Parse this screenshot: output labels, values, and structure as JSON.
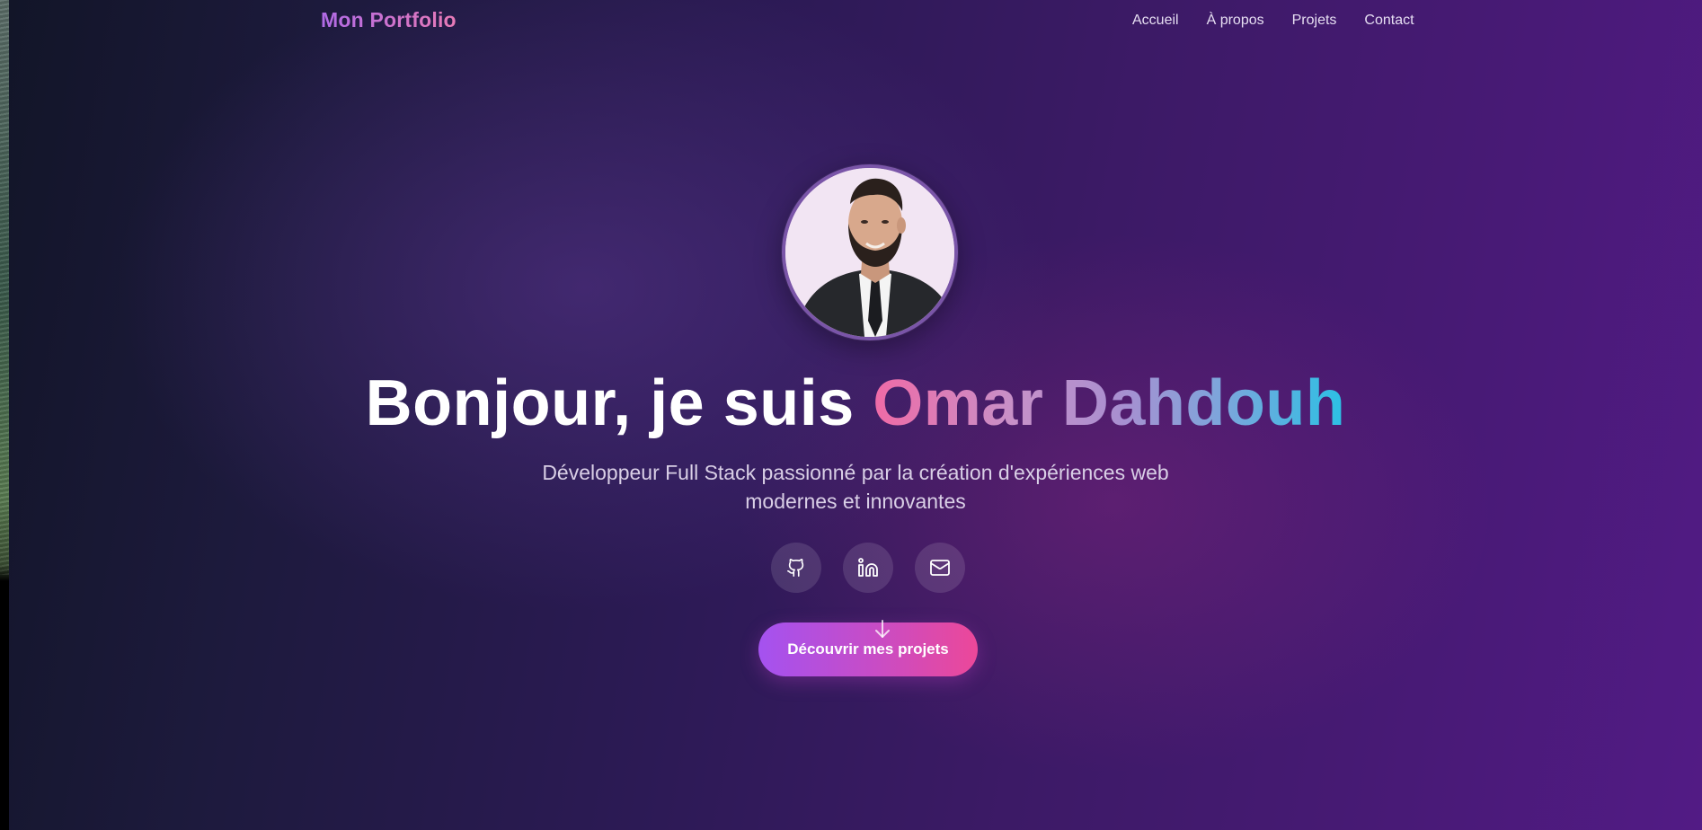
{
  "nav": {
    "brand": "Mon Portfolio",
    "links": [
      "Accueil",
      "À propos",
      "Projets",
      "Contact"
    ]
  },
  "hero": {
    "greeting": "Bonjour, je suis ",
    "name": "Omar Dahdouh",
    "subtitle_line1": "Développeur Full Stack passionné par la création d'expériences web",
    "subtitle_line2": "modernes et innovantes",
    "cta_label": "Découvrir mes projets"
  },
  "socials": [
    {
      "icon": "github-icon"
    },
    {
      "icon": "linkedin-icon"
    },
    {
      "icon": "mail-icon"
    }
  ],
  "colors": {
    "brand_gradient_start": "#b06ae6",
    "brand_gradient_end": "#e77ab6",
    "cta_start": "#a452f0",
    "cta_end": "#ec4899",
    "name_gradient_start": "#f06aa6",
    "name_gradient_end": "#2bc0e4"
  }
}
